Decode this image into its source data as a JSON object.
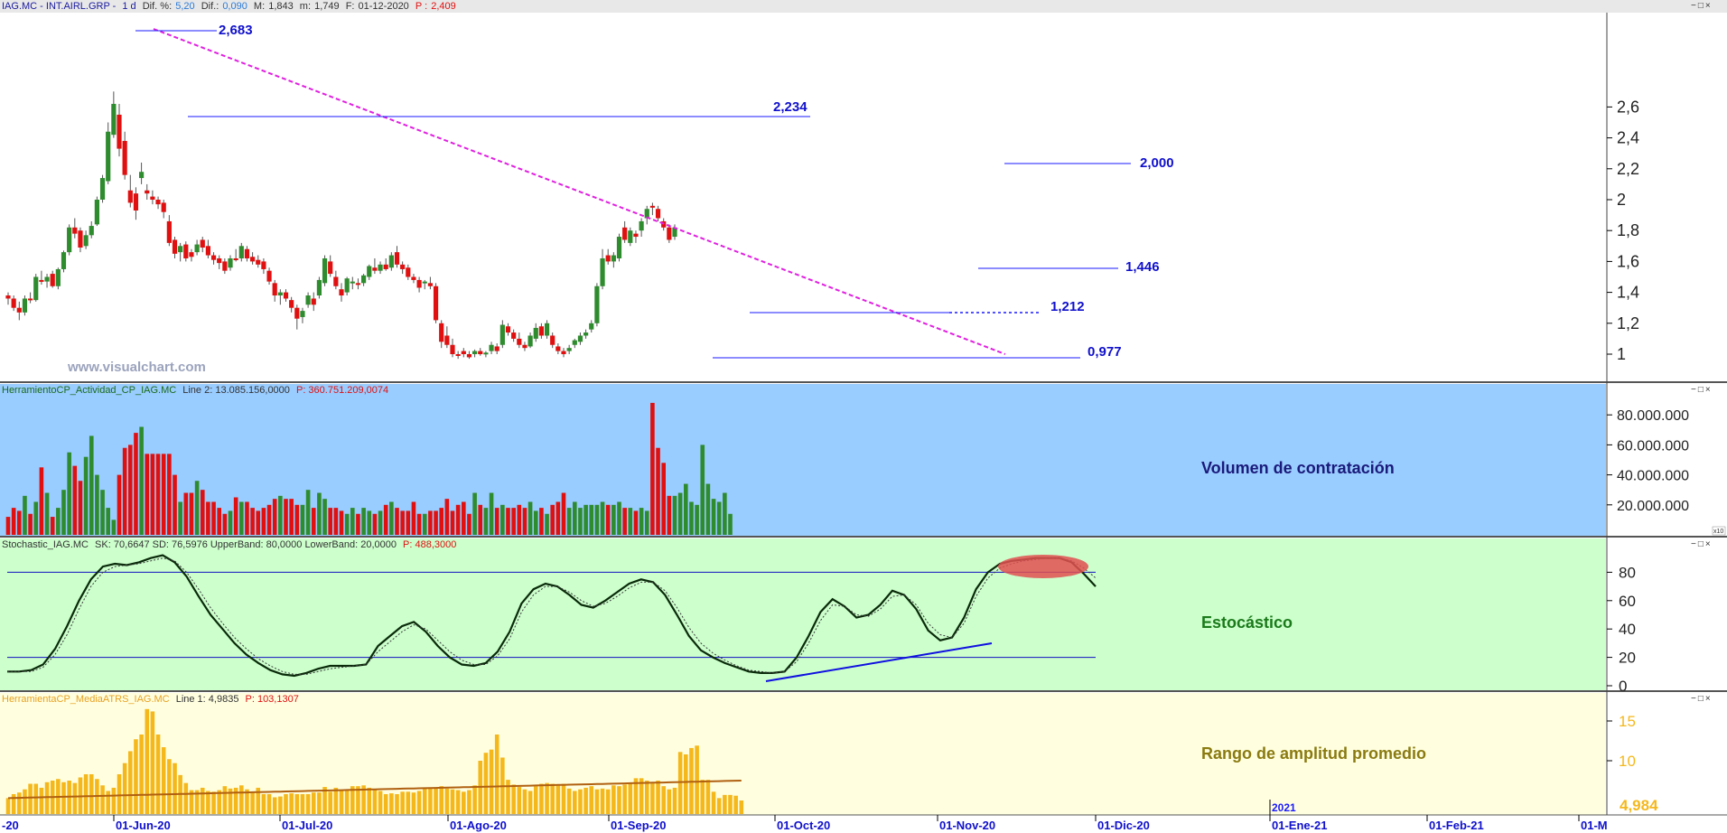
{
  "header": {
    "symbol": "IAG.MC - INT.AIRL.GRP -",
    "period": "1 d",
    "dif_pct_label": "Dif. %:",
    "dif_pct": "5,20",
    "dif_label": "Dif.:",
    "dif": "0,090",
    "max_label": "M:",
    "max": "1,843",
    "min_label": "m:",
    "min": "1,749",
    "date_label": "F:",
    "date": "01-12-2020",
    "p_label": "P :",
    "p": "2,409"
  },
  "window_controls": "−□×",
  "watermark": "www.visualchart.com",
  "price_panel": {
    "y_ticks": [
      "2,6",
      "2,4",
      "2,2",
      "2",
      "1,8",
      "1,6",
      "1,4",
      "1,2",
      "1"
    ],
    "levels": [
      "2,683",
      "2,234",
      "2,000",
      "1,446",
      "1,212",
      "0,977"
    ]
  },
  "volume_panel": {
    "header_name": "HerramientoCP_Actividad_CP_IAG.MC",
    "header_line": "Line 2: 13.085.156,0000",
    "header_p": "P: 360.751.209,0074",
    "title": "Volumen de contratación",
    "y_ticks": [
      "80.000.000",
      "60.000.000",
      "40.000.000",
      "20.000.000"
    ],
    "scale_tag": "x10"
  },
  "stoch_panel": {
    "header_name": "Stochastic_IAG.MC",
    "header_params": "SK: 70,6647  SD: 76,5976  UpperBand: 80,0000  LowerBand: 20,0000",
    "header_p": "P: 488,3000",
    "title": "Estocástico",
    "y_ticks": [
      "80",
      "60",
      "40",
      "20",
      "0"
    ]
  },
  "atr_panel": {
    "header_name": "HerramientaCP_MediaATRS_IAG.MC",
    "header_line": "Line 1: 4,9835",
    "header_p": "P: 103,1307",
    "title": "Rango de amplitud promedio",
    "y_ticks": [
      "15",
      "10"
    ],
    "last_value": "4,984"
  },
  "x_axis": {
    "labels": [
      "-20",
      "01-Jun-20",
      "01-Jul-20",
      "01-Ago-20",
      "01-Sep-20",
      "01-Oct-20",
      "01-Nov-20",
      "01-Dic-20",
      "01-Ene-21",
      "01-Feb-21",
      "01-M"
    ],
    "year_label": "2021"
  },
  "colors": {
    "up": "#2e8b2e",
    "down": "#e01010",
    "neutral": "#1010e0",
    "trendline": "#e020e0",
    "level_line": "#1a1aff",
    "volume_bg": "#99ccff",
    "stoch_bg": "#ccffcc",
    "atr_bg": "#ffffe0",
    "atr_bar": "#f5b81c",
    "atr_line": "#b06010"
  },
  "chart_data": [
    {
      "type": "candlestick",
      "ylim": [
        0.95,
        2.75
      ],
      "ohlc": [
        [
          1.38,
          1.4,
          1.32,
          1.36
        ],
        [
          1.36,
          1.38,
          1.28,
          1.3
        ],
        [
          1.3,
          1.34,
          1.22,
          1.27
        ],
        [
          1.27,
          1.38,
          1.25,
          1.36
        ],
        [
          1.36,
          1.4,
          1.33,
          1.35
        ],
        [
          1.35,
          1.52,
          1.34,
          1.5
        ],
        [
          1.48,
          1.54,
          1.45,
          1.47
        ],
        [
          1.47,
          1.52,
          1.43,
          1.5
        ],
        [
          1.52,
          1.54,
          1.43,
          1.44
        ],
        [
          1.44,
          1.56,
          1.42,
          1.55
        ],
        [
          1.55,
          1.67,
          1.53,
          1.66
        ],
        [
          1.66,
          1.84,
          1.64,
          1.82
        ],
        [
          1.82,
          1.88,
          1.75,
          1.78
        ],
        [
          1.8,
          1.82,
          1.66,
          1.69
        ],
        [
          1.7,
          1.8,
          1.68,
          1.77
        ],
        [
          1.77,
          1.86,
          1.75,
          1.83
        ],
        [
          1.84,
          2.02,
          1.83,
          2.0
        ],
        [
          2.0,
          2.16,
          1.98,
          2.14
        ],
        [
          2.12,
          2.5,
          2.1,
          2.44
        ],
        [
          2.42,
          2.7,
          2.4,
          2.62
        ],
        [
          2.55,
          2.62,
          2.28,
          2.33
        ],
        [
          2.38,
          2.44,
          2.13,
          2.16
        ],
        [
          2.06,
          2.16,
          1.95,
          1.98
        ],
        [
          2.04,
          2.08,
          1.87,
          1.93
        ],
        [
          2.14,
          2.24,
          2.1,
          2.18
        ],
        [
          2.06,
          2.1,
          2.0,
          2.04
        ],
        [
          2.02,
          2.06,
          1.97,
          2.0
        ],
        [
          2.0,
          2.02,
          1.94,
          1.97
        ],
        [
          1.98,
          2.0,
          1.88,
          1.92
        ],
        [
          1.86,
          1.9,
          1.7,
          1.72
        ],
        [
          1.74,
          1.76,
          1.62,
          1.65
        ],
        [
          1.66,
          1.72,
          1.6,
          1.7
        ],
        [
          1.71,
          1.73,
          1.6,
          1.62
        ],
        [
          1.66,
          1.68,
          1.6,
          1.63
        ],
        [
          1.66,
          1.74,
          1.64,
          1.71
        ],
        [
          1.74,
          1.76,
          1.66,
          1.69
        ],
        [
          1.7,
          1.74,
          1.62,
          1.64
        ],
        [
          1.64,
          1.66,
          1.58,
          1.61
        ],
        [
          1.62,
          1.64,
          1.55,
          1.59
        ],
        [
          1.6,
          1.62,
          1.52,
          1.54
        ],
        [
          1.56,
          1.64,
          1.54,
          1.62
        ],
        [
          1.62,
          1.68,
          1.6,
          1.61
        ],
        [
          1.62,
          1.72,
          1.6,
          1.7
        ],
        [
          1.68,
          1.7,
          1.6,
          1.62
        ],
        [
          1.63,
          1.66,
          1.58,
          1.6
        ],
        [
          1.61,
          1.64,
          1.56,
          1.58
        ],
        [
          1.6,
          1.62,
          1.52,
          1.55
        ],
        [
          1.54,
          1.56,
          1.45,
          1.47
        ],
        [
          1.46,
          1.48,
          1.34,
          1.38
        ],
        [
          1.38,
          1.42,
          1.32,
          1.4
        ],
        [
          1.4,
          1.42,
          1.34,
          1.36
        ],
        [
          1.35,
          1.37,
          1.27,
          1.3
        ],
        [
          1.3,
          1.32,
          1.16,
          1.23
        ],
        [
          1.24,
          1.3,
          1.2,
          1.28
        ],
        [
          1.32,
          1.4,
          1.3,
          1.38
        ],
        [
          1.36,
          1.4,
          1.28,
          1.32
        ],
        [
          1.38,
          1.5,
          1.36,
          1.48
        ],
        [
          1.46,
          1.64,
          1.44,
          1.62
        ],
        [
          1.6,
          1.64,
          1.5,
          1.52
        ],
        [
          1.5,
          1.54,
          1.42,
          1.44
        ],
        [
          1.42,
          1.46,
          1.34,
          1.38
        ],
        [
          1.4,
          1.5,
          1.38,
          1.49
        ],
        [
          1.46,
          1.5,
          1.42,
          1.47
        ],
        [
          1.46,
          1.49,
          1.42,
          1.45
        ],
        [
          1.46,
          1.52,
          1.44,
          1.51
        ],
        [
          1.5,
          1.58,
          1.48,
          1.57
        ],
        [
          1.56,
          1.62,
          1.52,
          1.54
        ],
        [
          1.54,
          1.6,
          1.52,
          1.58
        ],
        [
          1.58,
          1.62,
          1.54,
          1.55
        ],
        [
          1.56,
          1.66,
          1.54,
          1.64
        ],
        [
          1.66,
          1.7,
          1.56,
          1.58
        ],
        [
          1.58,
          1.6,
          1.52,
          1.55
        ],
        [
          1.56,
          1.58,
          1.48,
          1.5
        ],
        [
          1.5,
          1.52,
          1.46,
          1.48
        ],
        [
          1.48,
          1.5,
          1.4,
          1.43
        ],
        [
          1.46,
          1.48,
          1.42,
          1.47
        ],
        [
          1.46,
          1.5,
          1.42,
          1.44
        ],
        [
          1.44,
          1.46,
          1.2,
          1.22
        ],
        [
          1.2,
          1.22,
          1.04,
          1.08
        ],
        [
          1.12,
          1.18,
          1.04,
          1.06
        ],
        [
          1.06,
          1.1,
          0.98,
          1.0
        ],
        [
          1.0,
          1.02,
          0.97,
          0.99
        ],
        [
          1.02,
          1.04,
          0.98,
          1.0
        ],
        [
          1.0,
          1.02,
          0.97,
          0.98
        ],
        [
          1.0,
          1.03,
          0.98,
          1.02
        ],
        [
          1.02,
          1.04,
          0.99,
          1.0
        ],
        [
          1.0,
          1.02,
          0.98,
          1.01
        ],
        [
          1.02,
          1.08,
          1.0,
          1.06
        ],
        [
          1.05,
          1.07,
          1.0,
          1.02
        ],
        [
          1.06,
          1.22,
          1.04,
          1.19
        ],
        [
          1.18,
          1.2,
          1.12,
          1.14
        ],
        [
          1.14,
          1.16,
          1.08,
          1.1
        ],
        [
          1.1,
          1.14,
          1.04,
          1.06
        ],
        [
          1.06,
          1.08,
          1.02,
          1.04
        ],
        [
          1.05,
          1.14,
          1.04,
          1.12
        ],
        [
          1.1,
          1.2,
          1.08,
          1.17
        ],
        [
          1.18,
          1.2,
          1.1,
          1.12
        ],
        [
          1.12,
          1.22,
          1.1,
          1.2
        ],
        [
          1.12,
          1.14,
          1.04,
          1.06
        ],
        [
          1.05,
          1.07,
          1.0,
          1.02
        ],
        [
          1.02,
          1.04,
          0.98,
          1.0
        ],
        [
          1.02,
          1.06,
          1.0,
          1.04
        ],
        [
          1.06,
          1.1,
          1.04,
          1.09
        ],
        [
          1.08,
          1.14,
          1.06,
          1.12
        ],
        [
          1.12,
          1.16,
          1.1,
          1.14
        ],
        [
          1.16,
          1.22,
          1.14,
          1.2
        ],
        [
          1.2,
          1.46,
          1.18,
          1.44
        ],
        [
          1.44,
          1.68,
          1.42,
          1.62
        ],
        [
          1.64,
          1.68,
          1.58,
          1.6
        ],
        [
          1.6,
          1.66,
          1.56,
          1.64
        ],
        [
          1.62,
          1.78,
          1.6,
          1.76
        ],
        [
          1.82,
          1.86,
          1.72,
          1.74
        ],
        [
          1.72,
          1.82,
          1.7,
          1.8
        ],
        [
          1.78,
          1.8,
          1.72,
          1.76
        ],
        [
          1.8,
          1.88,
          1.76,
          1.86
        ],
        [
          1.88,
          1.96,
          1.84,
          1.94
        ],
        [
          1.96,
          1.98,
          1.9,
          1.95
        ],
        [
          1.94,
          1.96,
          1.86,
          1.88
        ],
        [
          1.86,
          1.88,
          1.8,
          1.82
        ],
        [
          1.82,
          1.84,
          1.72,
          1.74
        ],
        [
          1.76,
          1.84,
          1.74,
          1.82
        ]
      ]
    },
    {
      "type": "bar",
      "ylim": [
        0,
        100000000
      ],
      "values": [
        12,
        18,
        16,
        26,
        14,
        22,
        45,
        28,
        12,
        18,
        30,
        55,
        46,
        36,
        52,
        66,
        40,
        30,
        18,
        10,
        40,
        58,
        60,
        68,
        72,
        54,
        54,
        54,
        54,
        54,
        40,
        22,
        28,
        28,
        36,
        30,
        22,
        22,
        18,
        14,
        16,
        25,
        22,
        22,
        18,
        16,
        18,
        20,
        24,
        26,
        24,
        24,
        20,
        20,
        30,
        18,
        28,
        24,
        18,
        18,
        16,
        14,
        18,
        14,
        18,
        16,
        14,
        16,
        20,
        22,
        18,
        16,
        16,
        22,
        14,
        14,
        16,
        16,
        18,
        24,
        16,
        20,
        22,
        14,
        28,
        20,
        18,
        28,
        18,
        20,
        18,
        18,
        20,
        18,
        22,
        16,
        18,
        14,
        20,
        22,
        28,
        18,
        22,
        18,
        20,
        20,
        20,
        22,
        20,
        20,
        22,
        18,
        18,
        16,
        18,
        16,
        88,
        58,
        48,
        26,
        26,
        28,
        34,
        22,
        20,
        60,
        34,
        24,
        22,
        28,
        14
      ]
    },
    {
      "type": "line",
      "ylim": [
        0,
        100
      ],
      "upper_band": 80,
      "lower_band": 20,
      "series": [
        {
          "values": [
            10,
            10,
            11,
            15,
            26,
            42,
            60,
            75,
            84,
            86,
            85,
            87,
            90,
            92,
            87,
            77,
            63,
            50,
            40,
            30,
            22,
            16,
            11,
            8,
            7,
            9,
            12,
            14,
            14,
            14,
            15,
            28,
            35,
            42,
            45,
            38,
            28,
            20,
            15,
            14,
            16,
            24,
            38,
            58,
            68,
            72,
            70,
            64,
            57,
            55,
            60,
            66,
            72,
            75,
            73,
            64,
            50,
            35,
            25,
            20,
            16,
            13,
            10,
            9,
            9,
            10,
            20,
            35,
            52,
            61,
            56,
            48,
            50,
            57,
            67,
            64,
            54,
            39,
            32,
            34,
            48,
            68,
            80,
            86,
            88,
            89,
            90,
            90,
            90,
            87,
            79,
            70
          ]
        },
        {
          "values": [
            10,
            10,
            10,
            13,
            22,
            36,
            54,
            70,
            80,
            84,
            85,
            86,
            88,
            90,
            88,
            80,
            68,
            55,
            44,
            34,
            26,
            19,
            14,
            10,
            8,
            8,
            10,
            12,
            13,
            14,
            15,
            24,
            31,
            38,
            43,
            40,
            32,
            24,
            18,
            15,
            15,
            21,
            33,
            52,
            64,
            70,
            70,
            66,
            60,
            56,
            58,
            63,
            69,
            73,
            73,
            67,
            55,
            41,
            30,
            23,
            18,
            14,
            11,
            10,
            9,
            10,
            17,
            30,
            46,
            57,
            56,
            50,
            49,
            54,
            63,
            64,
            57,
            44,
            36,
            34,
            44,
            63,
            76,
            83,
            86,
            88,
            89,
            90,
            90,
            88,
            83,
            76
          ]
        }
      ]
    },
    {
      "type": "bar",
      "ylim": [
        2.5,
        17
      ],
      "values": [
        5.3,
        5.8,
        6,
        6.4,
        7.1,
        7.1,
        6.6,
        7.3,
        7.5,
        7.7,
        7.3,
        7.5,
        7.2,
        7.9,
        8.3,
        8.3,
        7.7,
        6.9,
        6.2,
        6.6,
        8.3,
        9.7,
        11.2,
        12.7,
        13.3,
        16.5,
        16.2,
        13.3,
        11.7,
        10.2,
        9.7,
        8.2,
        7.2,
        6.3,
        6.3,
        6.6,
        6.2,
        6.1,
        6.3,
        6.8,
        6.5,
        6.6,
        6.9,
        6.4,
        6.1,
        6.6,
        5.8,
        5.8,
        5.4,
        5.5,
        5.8,
        5.9,
        5.8,
        5.8,
        5.8,
        6,
        6,
        6.7,
        6.1,
        6.6,
        6.3,
        6.3,
        6.8,
        6.8,
        6.9,
        6.6,
        6.4,
        6.2,
        5.8,
        5.9,
        5.8,
        6.1,
        6.1,
        6,
        6.2,
        6.5,
        6.6,
        6.6,
        6.8,
        6.5,
        6.4,
        6.3,
        6.1,
        6.3,
        6.9,
        10,
        11,
        11.4,
        13.3,
        10.4,
        7.6,
        7,
        6.7,
        6.4,
        6.2,
        6.8,
        7.1,
        7.2,
        7.1,
        7,
        7.1,
        6.5,
        6.2,
        6.4,
        6.6,
        6.8,
        6.4,
        6.5,
        6.4,
        6.9,
        6.8,
        7,
        7.2,
        7.8,
        7.8,
        7.5,
        7.2,
        7.5,
        6.8,
        6.4,
        6.6,
        11.1,
        10.8,
        11.6,
        11.9,
        7.6,
        7.6,
        6.1,
        5.3,
        5.7,
        5.7,
        5.6,
        5
      ]
    }
  ]
}
